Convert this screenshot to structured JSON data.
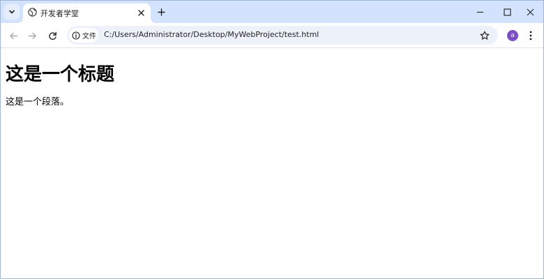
{
  "browser": {
    "tab": {
      "title": "开发者学堂",
      "favicon": "globe-icon"
    },
    "toolbar": {
      "site_info_label": "文件",
      "url": "C:/Users/Administrator/Desktop/MyWebProject/test.html",
      "profile_initial": "a"
    },
    "colors": {
      "tabstrip": "#d3e3fd",
      "omnibox": "#edf2fa",
      "avatar": "#7b4fc4"
    },
    "icons": {
      "tab_search": "chevron-down-icon",
      "tab_close": "close-icon",
      "new_tab": "plus-icon",
      "minimize": "minimize-icon",
      "maximize": "maximize-icon",
      "close_window": "close-icon",
      "back": "arrow-left-icon",
      "forward": "arrow-right-icon",
      "reload": "reload-icon",
      "site_info": "info-icon",
      "bookmark": "star-icon",
      "menu": "kebab-menu-icon"
    }
  },
  "page": {
    "heading": "这是一个标题",
    "paragraph": "这是一个段落。"
  }
}
